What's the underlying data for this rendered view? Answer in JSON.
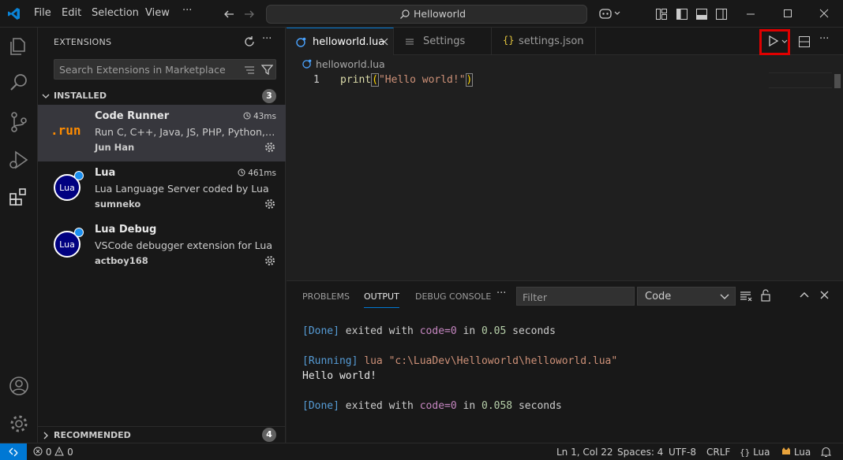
{
  "titlebar": {
    "menu": [
      "File",
      "Edit",
      "Selection",
      "View"
    ],
    "more": "···",
    "command_center": "Helloworld"
  },
  "sidebar": {
    "title": "EXTENSIONS",
    "search_placeholder": "Search Extensions in Marketplace",
    "installed_label": "INSTALLED",
    "installed_count": "3",
    "recommended_label": "RECOMMENDED",
    "recommended_count": "4",
    "extensions": [
      {
        "name": "Code Runner",
        "desc": "Run C, C++, Java, JS, PHP, Python, Perl, Ruby, Go, Lua...",
        "publisher": "Jun Han",
        "time": "43ms",
        "logo": ".run"
      },
      {
        "name": "Lua",
        "desc": "Lua Language Server coded by Lua",
        "publisher": "sumneko",
        "time": "461ms",
        "logo": "Lua"
      },
      {
        "name": "Lua Debug",
        "desc": "VSCode debugger extension for Lua",
        "publisher": "actboy168",
        "time": "",
        "logo": "Lua"
      }
    ]
  },
  "editor": {
    "tabs": [
      {
        "label": "helloworld.lua",
        "active": true
      },
      {
        "label": "Settings",
        "active": false
      },
      {
        "label": "settings.json",
        "active": false
      }
    ],
    "breadcrumb": "helloworld.lua",
    "line_number": "1",
    "code": {
      "fn": "print",
      "open": "(",
      "str": "\"Hello world!\"",
      "close": ")"
    }
  },
  "panel": {
    "tabs": [
      "PROBLEMS",
      "OUTPUT",
      "DEBUG CONSOLE"
    ],
    "active_tab": "OUTPUT",
    "more": "···",
    "filter_placeholder": "Filter",
    "channel": "Code",
    "output": [
      {
        "tag": "[Done]",
        "rest1": " exited with ",
        "key": "code=0",
        "rest2": " in ",
        "num": "0.05",
        "rest3": " seconds"
      },
      {
        "tag": "[Running]",
        "text": " lua \"c:\\LuaDev\\Helloworld\\helloworld.lua\""
      },
      {
        "plain": "Hello world!"
      },
      {
        "tag": "[Done]",
        "rest1": " exited with ",
        "key": "code=0",
        "rest2": " in ",
        "num": "0.058",
        "rest3": " seconds"
      }
    ]
  },
  "statusbar": {
    "errors": "0",
    "warnings": "0",
    "position": "Ln 1, Col 22",
    "spaces": "Spaces: 4",
    "encoding": "UTF-8",
    "eol": "CRLF",
    "language": "Lua",
    "lua_status": "Lua"
  },
  "colors": {
    "accent": "#0078d4",
    "highlight_box": "#e00000",
    "run_logo": "#ff8c00"
  }
}
